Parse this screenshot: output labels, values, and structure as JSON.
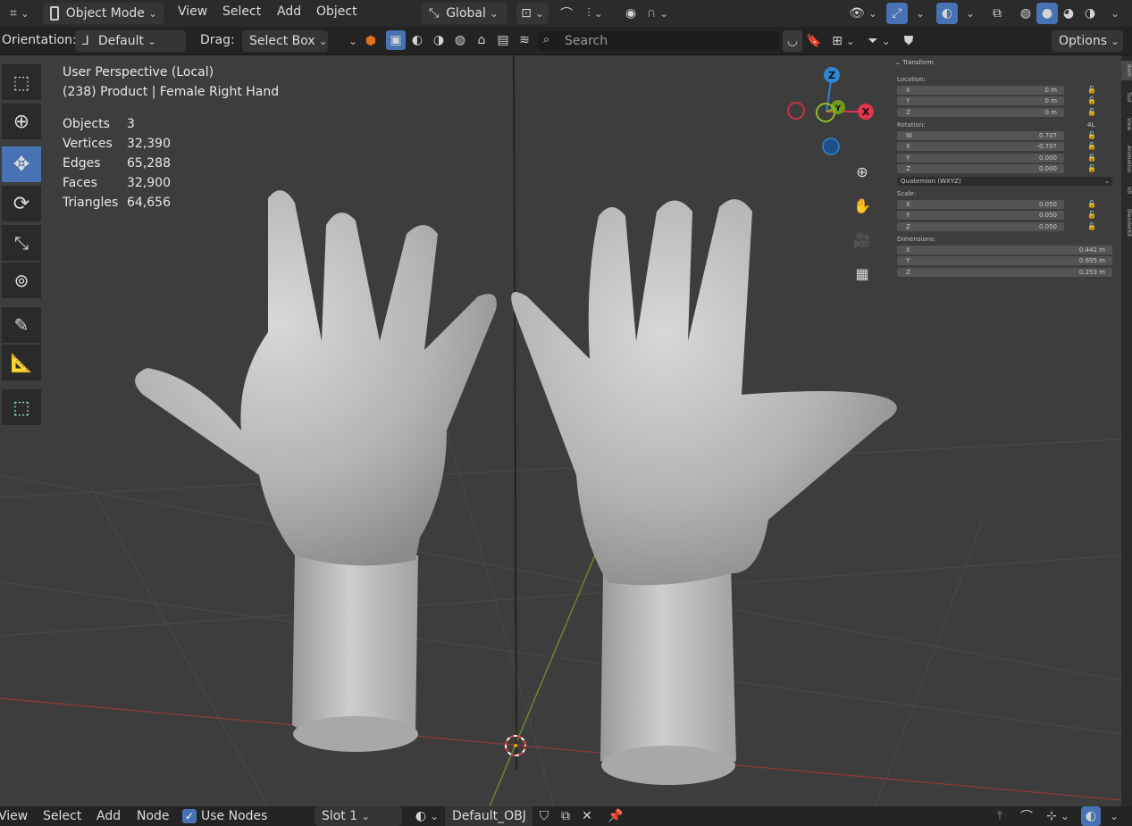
{
  "header": {
    "mode": "Object Mode",
    "menus": [
      "View",
      "Select",
      "Add",
      "Object"
    ],
    "transform_orientation": "Global",
    "options": "Options"
  },
  "toolbar2": {
    "orientation_label": "Orientation:",
    "orientation_value": "Default",
    "drag_label": "Drag:",
    "drag_value": "Select Box",
    "search_placeholder": "Search"
  },
  "viewport": {
    "perspective": "User Perspective (Local)",
    "object_info": "(238) Product | Female Right Hand",
    "stats": [
      {
        "label": "Objects",
        "value": "3"
      },
      {
        "label": "Vertices",
        "value": "32,390"
      },
      {
        "label": "Edges",
        "value": "65,288"
      },
      {
        "label": "Faces",
        "value": "32,900"
      },
      {
        "label": "Triangles",
        "value": "64,656"
      }
    ]
  },
  "gizmo": {
    "x": "X",
    "y": "Y",
    "z": "Z"
  },
  "npanel": {
    "section": "Transform",
    "location_label": "Location:",
    "location": [
      {
        "axis": "X",
        "value": "0 m"
      },
      {
        "axis": "Y",
        "value": "0 m"
      },
      {
        "axis": "Z",
        "value": "0 m"
      }
    ],
    "rotation_label": "Rotation:",
    "rotation_tag": "4L",
    "rotation": [
      {
        "axis": "W",
        "value": "0.707"
      },
      {
        "axis": "X",
        "value": "-0.707"
      },
      {
        "axis": "Y",
        "value": "0.000"
      },
      {
        "axis": "Z",
        "value": "0.000"
      }
    ],
    "rotation_mode": "Quaternion (WXYZ)",
    "scale_label": "Scale:",
    "scale": [
      {
        "axis": "X",
        "value": "0.050"
      },
      {
        "axis": "Y",
        "value": "0.050"
      },
      {
        "axis": "Z",
        "value": "0.050"
      }
    ],
    "dimensions_label": "Dimensions:",
    "dimensions": [
      {
        "axis": "X",
        "value": "0.441 m"
      },
      {
        "axis": "Y",
        "value": "0.695 m"
      },
      {
        "axis": "Z",
        "value": "0.253 m"
      }
    ],
    "tabs": [
      "Item",
      "Tool",
      "View",
      "Animation",
      "VR",
      "BlenderKit"
    ]
  },
  "bottom": {
    "menus": [
      "View",
      "Select",
      "Add",
      "Node"
    ],
    "use_nodes": "Use Nodes",
    "slot": "Slot 1",
    "material": "Default_OBJ"
  },
  "colors": {
    "accent": "#4772b3",
    "x_axis": "#e2334f",
    "y_axis": "#8bbd21",
    "z_axis": "#2e87d4"
  }
}
